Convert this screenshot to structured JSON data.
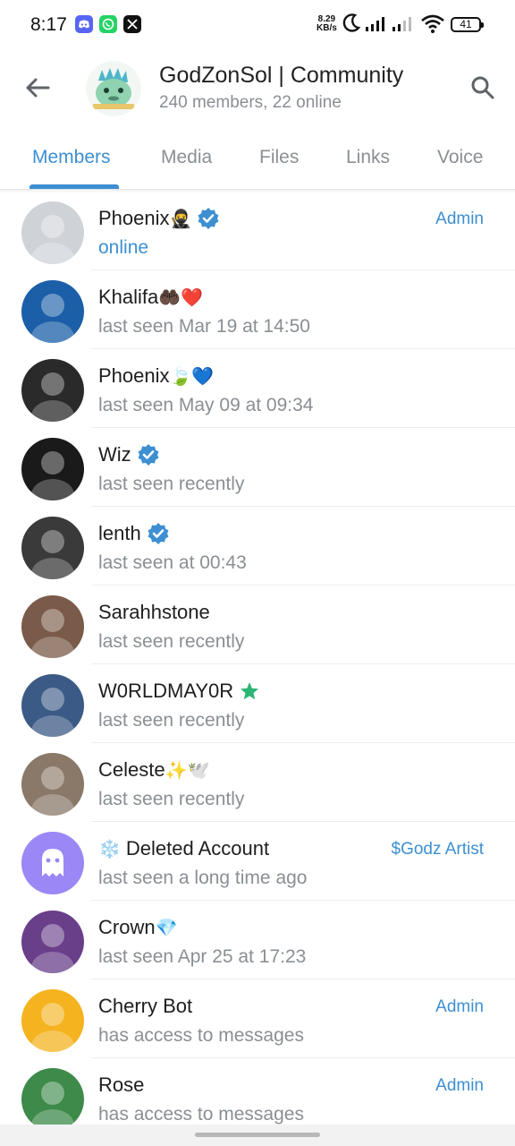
{
  "status_bar": {
    "time": "8:17",
    "net_speed_value": "8.29",
    "net_speed_unit": "KB/s",
    "battery": "41",
    "apps": [
      "discord-icon",
      "whatsapp-icon",
      "x-icon"
    ]
  },
  "header": {
    "title": "GodZonSol | Community",
    "subtitle": "240 members, 22 online"
  },
  "tabs": [
    {
      "label": "Members",
      "active": true
    },
    {
      "label": "Media",
      "active": false
    },
    {
      "label": "Files",
      "active": false
    },
    {
      "label": "Links",
      "active": false
    },
    {
      "label": "Voice",
      "active": false
    }
  ],
  "colors": {
    "accent": "#3d8fd1",
    "muted": "#8a8f94",
    "verified": "#3d8fd1",
    "premium_star": "#2bb673"
  },
  "members": [
    {
      "name": "Phoenix",
      "emoji": "🥷",
      "badge": "verified",
      "status": "online",
      "role": "Admin",
      "avatar_color": "#cfd3d8"
    },
    {
      "name": "Khalifa",
      "emoji": "🤲🏿❤️",
      "badge": "",
      "status": "last seen Mar 19 at 14:50",
      "role": "",
      "avatar_color": "#1b5fa8"
    },
    {
      "name": "Phoenix",
      "emoji": "🍃💙",
      "badge": "",
      "status": "last seen May 09 at 09:34",
      "role": "",
      "avatar_color": "#2a2a2a"
    },
    {
      "name": "Wiz",
      "emoji": "",
      "badge": "verified",
      "status": "last seen recently",
      "role": "",
      "avatar_color": "#1a1a1a"
    },
    {
      "name": "lenth",
      "emoji": "",
      "badge": "verified",
      "status": "last seen at 00:43",
      "role": "",
      "avatar_color": "#3a3a3a"
    },
    {
      "name": "Sarahhstone",
      "emoji": "",
      "badge": "",
      "status": "last seen recently",
      "role": "",
      "avatar_color": "#7a5a48"
    },
    {
      "name": "W0RLDMAY0R",
      "emoji": "",
      "badge": "star",
      "status": "last seen recently",
      "role": "",
      "avatar_color": "#3c5a86"
    },
    {
      "name": "Celeste",
      "emoji": "✨🕊️",
      "badge": "",
      "status": "last seen recently",
      "role": "",
      "avatar_color": "#8a7868"
    },
    {
      "name": "Deleted Account",
      "emoji": "❄️",
      "badge": "",
      "status": "last seen a long time ago",
      "role": "$Godz Artist",
      "avatar_color": "#9b87f5",
      "deleted": true
    },
    {
      "name": "Crown",
      "emoji": "💎",
      "badge": "",
      "status": "last seen Apr 25 at 17:23",
      "role": "",
      "avatar_color": "#6a3f8a"
    },
    {
      "name": "Cherry Bot",
      "emoji": "",
      "badge": "",
      "status": "has access to messages",
      "role": "Admin",
      "avatar_color": "#f5b320"
    },
    {
      "name": "Rose",
      "emoji": "",
      "badge": "",
      "status": "has access to messages",
      "role": "Admin",
      "avatar_color": "#3d8a4a"
    }
  ]
}
